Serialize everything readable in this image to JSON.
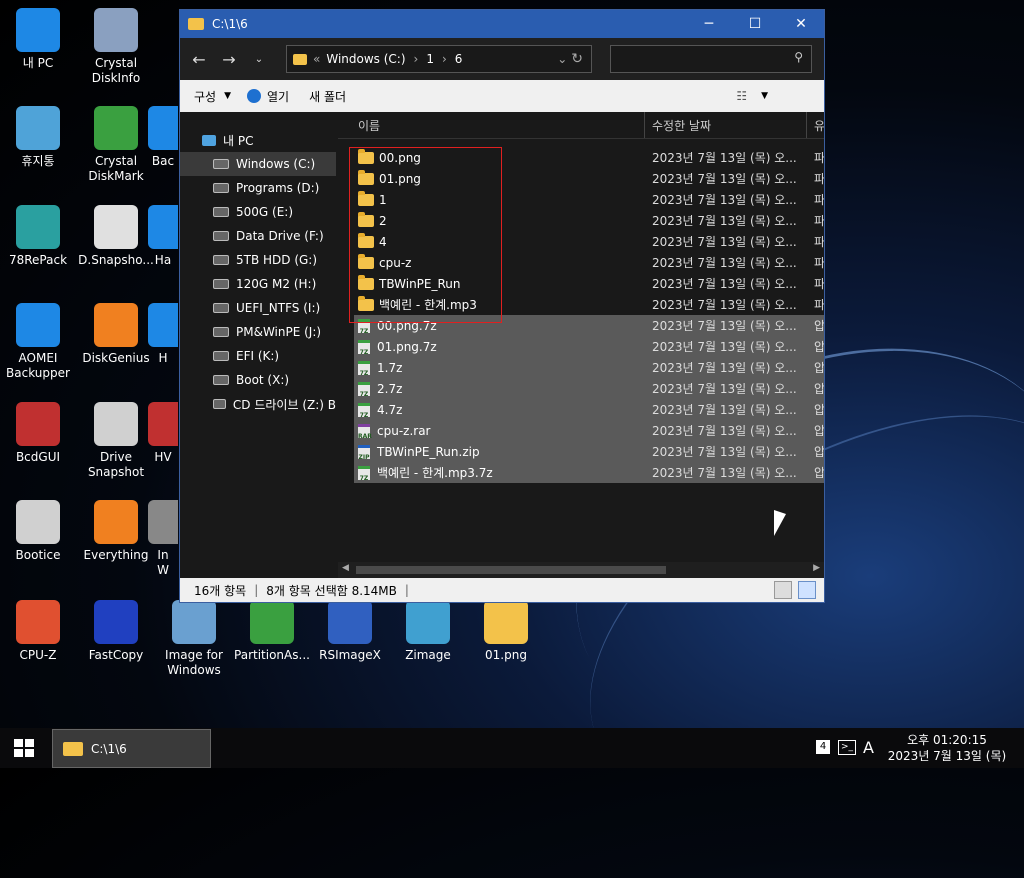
{
  "desktop_icons": [
    {
      "label": "내 PC",
      "color": "#1e88e5"
    },
    {
      "label": "Crystal DiskInfo",
      "color": "#8aa0c0"
    },
    {
      "label": "휴지통",
      "color": "#4fa3d8"
    },
    {
      "label": "Crystal DiskMark",
      "color": "#3aa040"
    },
    {
      "label": "78RePack",
      "color": "#2aa0a0"
    },
    {
      "label": "D.Snapsho...",
      "color": "#e0e0e0"
    },
    {
      "label": "AOMEI Backupper",
      "color": "#1e88e5"
    },
    {
      "label": "DiskGenius",
      "color": "#f08020"
    },
    {
      "label": "BcdGUI",
      "color": "#c03030"
    },
    {
      "label": "Drive Snapshot",
      "color": "#d0d0d0"
    },
    {
      "label": "Bootice",
      "color": "#d0d0d0"
    },
    {
      "label": "Everything",
      "color": "#f08020"
    },
    {
      "label": "CPU-Z",
      "color": "#e05030"
    },
    {
      "label": "FastCopy",
      "color": "#2040c0"
    },
    {
      "label": "Image for Windows",
      "color": "#6aa0d0"
    },
    {
      "label": "PartitionAs...",
      "color": "#3aa040"
    },
    {
      "label": "RSImageX",
      "color": "#3060c0"
    },
    {
      "label": "Zimage",
      "color": "#40a0d0"
    },
    {
      "label": "01.png",
      "color": "#f3c24a"
    },
    {
      "label": "Bac",
      "color": "#1e88e5"
    },
    {
      "label": "Ha",
      "color": "#1e88e5"
    },
    {
      "label": "H",
      "color": "#1e88e5"
    },
    {
      "label": "HV",
      "color": "#c03030"
    },
    {
      "label": "In\nW",
      "color": "#888"
    }
  ],
  "window": {
    "title": "C:\\1\\6",
    "address": {
      "prefix": "«",
      "parts": [
        "Windows (C:)",
        "1",
        "6"
      ]
    },
    "search_placeholder": "",
    "commands": {
      "organize": "구성",
      "open": "열기",
      "new_folder": "새 폴더"
    },
    "nav_pane": [
      {
        "label": "내 PC",
        "icon": "pc-icon"
      },
      {
        "label": "Windows (C:)",
        "icon": "drive-icon",
        "selected": true
      },
      {
        "label": "Programs (D:)",
        "icon": "drive-icon"
      },
      {
        "label": "500G (E:)",
        "icon": "drive-icon"
      },
      {
        "label": "Data Drive (F:)",
        "icon": "drive-icon"
      },
      {
        "label": "5TB HDD (G:)",
        "icon": "drive-icon"
      },
      {
        "label": "120G M2 (H:)",
        "icon": "drive-icon"
      },
      {
        "label": "UEFI_NTFS (I:)",
        "icon": "drive-icon"
      },
      {
        "label": "PM&WinPE (J:)",
        "icon": "drive-icon"
      },
      {
        "label": "EFI (K:)",
        "icon": "drive-icon"
      },
      {
        "label": "Boot (X:)",
        "icon": "boot-drive-icon"
      },
      {
        "label": "CD 드라이브 (Z:) B",
        "icon": "cd-drive-icon"
      }
    ],
    "columns": {
      "name": "이름",
      "date": "수정한 날짜",
      "type": "유"
    },
    "files": [
      {
        "name": "00.png",
        "date": "2023년 7월 13일 (목) 오...",
        "type": "파",
        "kind": "folder",
        "selected": false
      },
      {
        "name": "01.png",
        "date": "2023년 7월 13일 (목) 오...",
        "type": "파",
        "kind": "folder",
        "selected": false
      },
      {
        "name": "1",
        "date": "2023년 7월 13일 (목) 오...",
        "type": "파",
        "kind": "folder",
        "selected": false
      },
      {
        "name": "2",
        "date": "2023년 7월 13일 (목) 오...",
        "type": "파",
        "kind": "folder",
        "selected": false
      },
      {
        "name": "4",
        "date": "2023년 7월 13일 (목) 오...",
        "type": "파",
        "kind": "folder",
        "selected": false
      },
      {
        "name": "cpu-z",
        "date": "2023년 7월 13일 (목) 오...",
        "type": "파",
        "kind": "folder",
        "selected": false
      },
      {
        "name": "TBWinPE_Run",
        "date": "2023년 7월 13일 (목) 오...",
        "type": "파",
        "kind": "folder",
        "selected": false
      },
      {
        "name": "백예린 - 한계.mp3",
        "date": "2023년 7월 13일 (목) 오...",
        "type": "파",
        "kind": "folder",
        "selected": false
      },
      {
        "name": "00.png.7z",
        "date": "2023년 7월 13일 (목) 오...",
        "type": "압",
        "kind": "7z",
        "selected": true
      },
      {
        "name": "01.png.7z",
        "date": "2023년 7월 13일 (목) 오...",
        "type": "압",
        "kind": "7z",
        "selected": true
      },
      {
        "name": "1.7z",
        "date": "2023년 7월 13일 (목) 오...",
        "type": "압",
        "kind": "7z",
        "selected": true
      },
      {
        "name": "2.7z",
        "date": "2023년 7월 13일 (목) 오...",
        "type": "압",
        "kind": "7z",
        "selected": true
      },
      {
        "name": "4.7z",
        "date": "2023년 7월 13일 (목) 오...",
        "type": "압",
        "kind": "7z",
        "selected": true
      },
      {
        "name": "cpu-z.rar",
        "date": "2023년 7월 13일 (목) 오...",
        "type": "압",
        "kind": "rar",
        "selected": true
      },
      {
        "name": "TBWinPE_Run.zip",
        "date": "2023년 7월 13일 (목) 오...",
        "type": "압",
        "kind": "zip",
        "selected": true
      },
      {
        "name": "백예린 - 한계.mp3.7z",
        "date": "2023년 7월 13일 (목) 오...",
        "type": "압",
        "kind": "7z",
        "selected": true
      }
    ],
    "status": {
      "count": "16개 항목",
      "selection": "8개 항목 선택함 8.14MB"
    }
  },
  "taskbar": {
    "window_button": "C:\\1\\6",
    "tray_badge": "4",
    "ime": "A",
    "time": "오후 01:20:15",
    "date": "2023년 7월 13일 (목)"
  },
  "colors": {
    "titlebar": "#2a5db0",
    "selection": "#5a5a5a",
    "highlight_border": "#e02020"
  }
}
